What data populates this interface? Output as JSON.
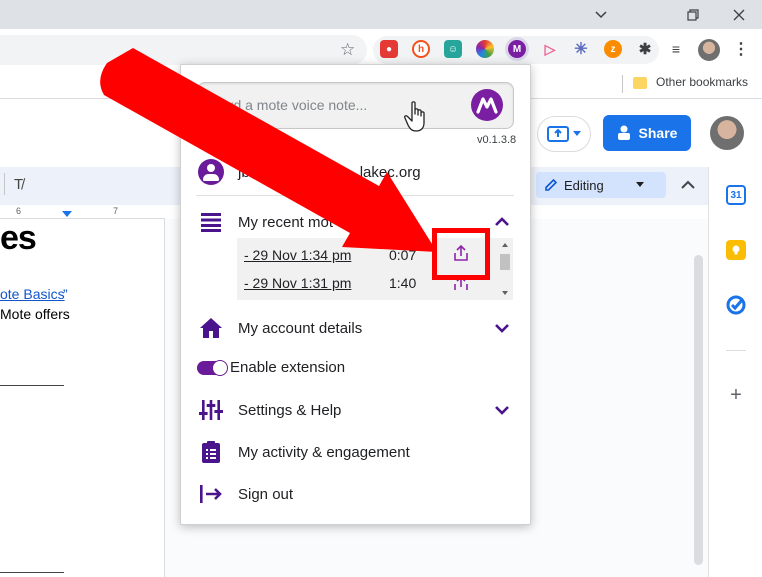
{
  "browser": {
    "bookmarks": {
      "other_label": "Other bookmarks"
    },
    "extensions": [
      "ublock-icon",
      "honey-icon",
      "grammarly-icon",
      "colorpicker-icon",
      "mote-icon",
      "screencastify-icon",
      "loom-icon",
      "zotero-icon",
      "puzzle-icon",
      "reading-list-icon"
    ]
  },
  "docs": {
    "share_label": "Share",
    "mode_label": "Editing",
    "ruler_marks": [
      "6",
      "7"
    ],
    "heading_fragment": "es",
    "link_fragment": "ote Basics",
    "quote_fragment": "”",
    "text_fragment": "Mote offers"
  },
  "popup": {
    "record_placeholder": "cord a mote voice note...",
    "version": "v0.1.3.8",
    "user_email": "jbadi",
    "user_email_tail": "lakec.org",
    "menu": {
      "recent_label": "My recent mot",
      "account_label": "My account details",
      "enable_label": "Enable extension",
      "settings_label": "Settings & Help",
      "activity_label": "My activity & engagement",
      "signout_label": "Sign out"
    },
    "recordings": [
      {
        "date": "- 29 Nov 1:34 pm",
        "duration": "0:07"
      },
      {
        "date": "- 29 Nov 1:31 pm",
        "duration": "1:40"
      }
    ],
    "extension_enabled": true
  },
  "colors": {
    "mote_purple": "#6a1b9a",
    "annotation_red": "#ff0000",
    "share_blue": "#1a73e8"
  }
}
